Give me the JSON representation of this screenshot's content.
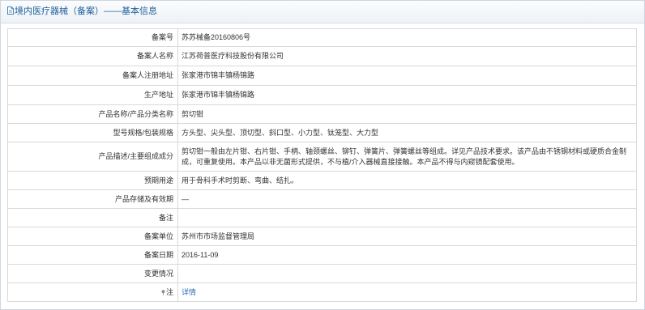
{
  "header": {
    "title": "境内医疗器械（备案）——基本信息",
    "icon": "document-icon"
  },
  "rows": [
    {
      "label": "备案号",
      "value": "苏苏械备20160806号"
    },
    {
      "label": "备案人名称",
      "value": "江苏荷普医疗科技股份有限公司"
    },
    {
      "label": "备案人注册地址",
      "value": "张家港市锦丰镇杨锦路"
    },
    {
      "label": "生产地址",
      "value": "张家港市锦丰镇杨锦路"
    },
    {
      "label": "产品名称/产品分类名称",
      "value": "剪切钳"
    },
    {
      "label": "型号规格/包装规格",
      "value": "方头型、尖头型、顶切型、斜口型、小力型、钛笼型、大力型"
    },
    {
      "label": "产品描述/主要组成成分",
      "value": "剪切钳一般由左片钳、右片钳、手柄、轴颈螺丝、铆钉、弹簧片、弹簧螺丝等组成。详见产品技术要求。该产品由不锈钢材料或硬质合金制成，可重复使用。本产品以非无菌形式提供，不与植/介入器械直接接触。本产品不得与内窥镜配套使用。"
    },
    {
      "label": "预期用途",
      "value": "用于骨科手术时剪断、弯曲、结扎。"
    },
    {
      "label": "产品存储及有效期",
      "value": "—"
    },
    {
      "label": "备注",
      "value": ""
    },
    {
      "label": "备案单位",
      "value": "苏州市市场监督管理局"
    },
    {
      "label": "备案日期",
      "value": "2016-11-09"
    },
    {
      "label": "变更情况",
      "value": ""
    },
    {
      "label": "注",
      "value": "详情",
      "icon": "pin-icon"
    }
  ],
  "colors": {
    "title": "#1e5f9e",
    "link": "#2f6fb6",
    "border": "#d9d9d9"
  }
}
